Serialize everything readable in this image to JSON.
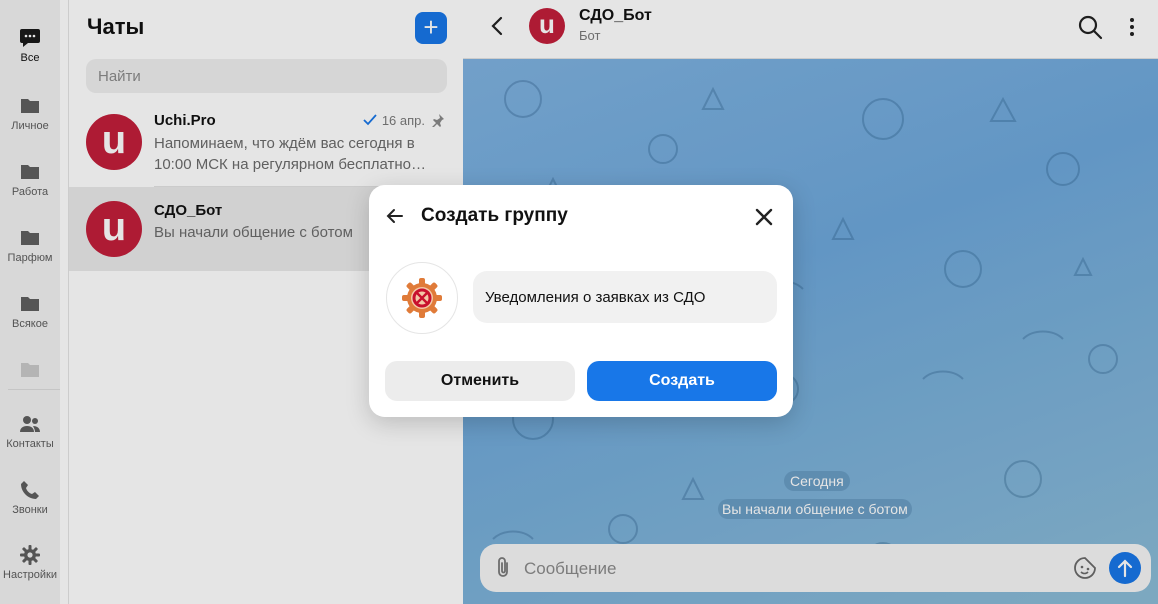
{
  "sidebar": {
    "items": [
      {
        "label": "Все",
        "icon": "chat-bubble-icon"
      },
      {
        "label": "Личное",
        "icon": "folder-icon"
      },
      {
        "label": "Работа",
        "icon": "folder-icon"
      },
      {
        "label": "Парфюм",
        "icon": "folder-icon"
      },
      {
        "label": "Всякое",
        "icon": "folder-icon"
      },
      {
        "label": "",
        "icon": "folder-icon"
      },
      {
        "label": "Контакты",
        "icon": "contacts-icon"
      },
      {
        "label": "Звонки",
        "icon": "phone-icon"
      },
      {
        "label": "Настройки",
        "icon": "gear-icon"
      }
    ]
  },
  "chat_list": {
    "title": "Чаты",
    "add_label": "+",
    "search_placeholder": "Найти",
    "chats": [
      {
        "name": "Uchi.Pro",
        "avatar_letter": "u",
        "date": "16 апр.",
        "message": "Напоминаем, что ждём вас сегодня в 10:00 МСК на регулярном бесплатно…",
        "read": true,
        "pinned": true
      },
      {
        "name": "СДО_Бот",
        "avatar_letter": "u",
        "message": "Вы начали общение с ботом",
        "selected": true
      }
    ]
  },
  "conversation": {
    "title": "СДО_Бот",
    "subtitle": "Бот",
    "avatar_letter": "u",
    "day_label": "Сегодня",
    "service_message": "Вы начали общение с ботом",
    "composer_placeholder": "Сообщение"
  },
  "modal": {
    "title": "Создать группу",
    "group_name_value": "Уведомления о заявках из СДО",
    "cancel_label": "Отменить",
    "create_label": "Создать"
  },
  "colors": {
    "accent": "#1877e8",
    "avatar_brand": "#c21f3a"
  }
}
